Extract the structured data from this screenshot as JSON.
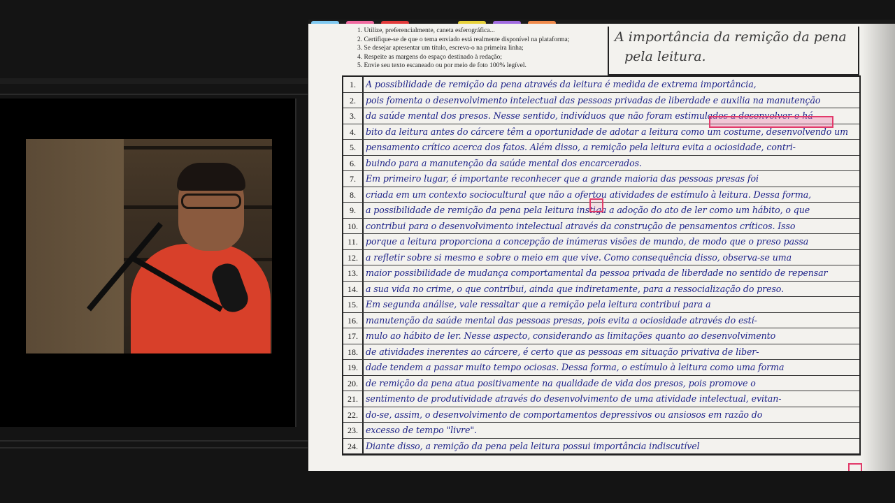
{
  "document": {
    "instructions": [
      "1. Utilize, preferencialmente, caneta esferográfica...",
      "2. Certifique-se de que o tema enviado está realmente disponível na plataforma;",
      "3. Se desejar apresentar um título, escreva-o na primeira linha;",
      "4. Respeite as margens do espaço destinado à redação;",
      "5. Envie seu texto escaneado ou por meio de foto 100% legível."
    ],
    "title_lines": [
      "A importância da remição da pena",
      "pela leitura."
    ],
    "lines": [
      {
        "n": "1.",
        "text": "A possibilidade de remição da pena através da leitura é medida de extrema importância,"
      },
      {
        "n": "2.",
        "text": "pois fomenta o desenvolvimento intelectual das pessoas privadas de liberdade e auxilia na manutenção"
      },
      {
        "n": "3.",
        "text": "da saúde mental dos presos. Nesse sentido, indivíduos que não foram estimulados a desenvolver o há-"
      },
      {
        "n": "4.",
        "text": "bito da leitura antes do cárcere têm a oportunidade de adotar a leitura como um costume, desenvolvendo um"
      },
      {
        "n": "5.",
        "text": "pensamento crítico acerca dos fatos. Além disso, a remição pela leitura evita a ociosidade, contri-"
      },
      {
        "n": "6.",
        "text": "buindo para a manutenção da saúde mental dos encarcerados."
      },
      {
        "n": "7.",
        "text": "      Em primeiro lugar, é importante reconhecer que a grande maioria das pessoas presas foi"
      },
      {
        "n": "8.",
        "text": "criada em um contexto sociocultural que não a ofertou atividades de estímulo à leitura. Dessa forma,"
      },
      {
        "n": "9.",
        "text": "a possibilidade de remição da pena pela leitura instiga a adoção do ato de ler como um hábito, o que"
      },
      {
        "n": "10.",
        "text": "contribui para o desenvolvimento intelectual através da construção de pensamentos críticos. Isso"
      },
      {
        "n": "11.",
        "text": "porque a leitura proporciona a concepção de inúmeras visões de mundo, de modo que o preso passa"
      },
      {
        "n": "12.",
        "text": "a refletir sobre si mesmo e sobre o meio em que vive. Como consequência disso, observa-se uma"
      },
      {
        "n": "13.",
        "text": "maior possibilidade de mudança comportamental da pessoa privada de liberdade no sentido de repensar"
      },
      {
        "n": "14.",
        "text": "a sua vida no crime, o que contribui, ainda que indiretamente, para a ressocialização do preso."
      },
      {
        "n": "15.",
        "text": "      Em segunda análise, vale ressaltar que a remição pela leitura contribui para a"
      },
      {
        "n": "16.",
        "text": "manutenção da saúde mental das pessoas presas, pois evita a ociosidade através do estí-"
      },
      {
        "n": "17.",
        "text": "mulo ao hábito de ler. Nesse aspecto, considerando as limitações quanto ao desenvolvimento"
      },
      {
        "n": "18.",
        "text": "de atividades inerentes ao cárcere, é certo que as pessoas em situação privativa de liber-"
      },
      {
        "n": "19.",
        "text": "dade tendem a passar muito tempo ociosas. Dessa forma, o estímulo à leitura como uma forma"
      },
      {
        "n": "20.",
        "text": "de remição da pena atua positivamente na qualidade de vida dos presos, pois promove o"
      },
      {
        "n": "21.",
        "text": "sentimento de produtividade através do desenvolvimento de uma atividade intelectual, evitan-"
      },
      {
        "n": "22.",
        "text": "do-se, assim, o desenvolvimento de comportamentos depressivos ou ansiosos em razão do"
      },
      {
        "n": "23.",
        "text": "excesso de tempo \"livre\"."
      },
      {
        "n": "24.",
        "text": "      Diante disso, a remição da pena pela leitura possui importância indiscutível"
      }
    ]
  },
  "colors": {
    "ink": "#1e2388",
    "highlight": "#e23a6a",
    "paper": "#f3f2ee",
    "background": "#141414"
  }
}
